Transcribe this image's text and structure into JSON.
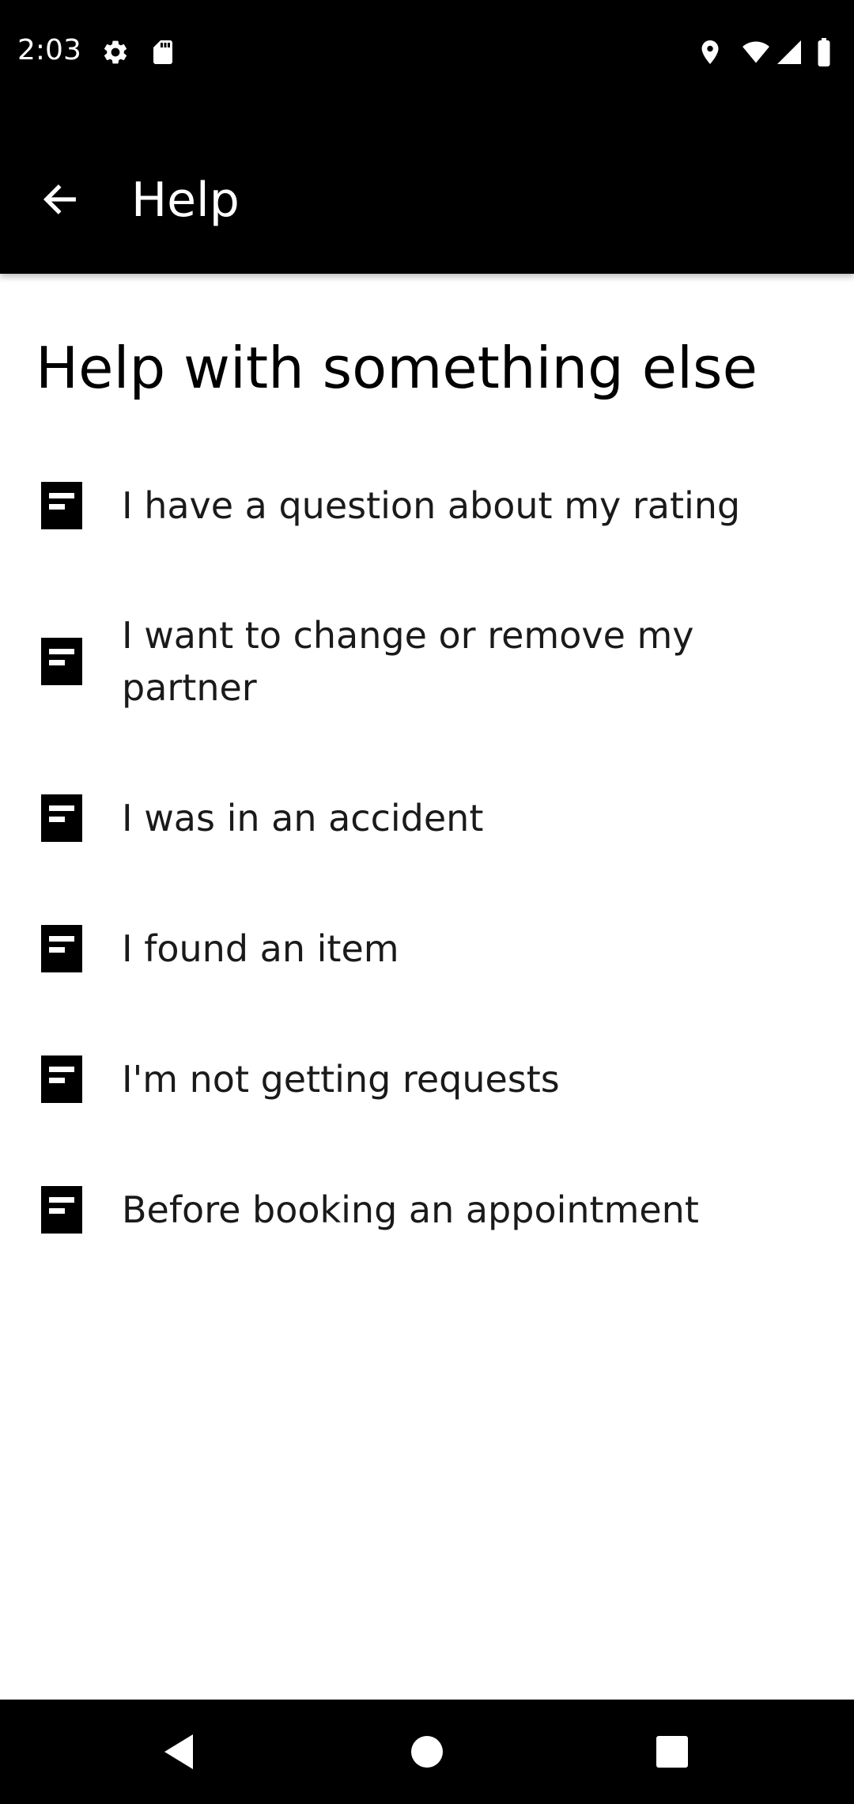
{
  "status_bar": {
    "time": "2:03",
    "icons_left": [
      "gear-icon",
      "sd-card-icon"
    ],
    "icons_right": [
      "location-icon",
      "wifi-icon",
      "signal-icon",
      "battery-icon"
    ]
  },
  "app_bar": {
    "title": "Help",
    "back_icon": "arrow-left-icon"
  },
  "section": {
    "title": "Help with something else"
  },
  "help_items": [
    {
      "label": "I have a question about my rating",
      "icon": "document-icon"
    },
    {
      "label": "I want to change or remove my partner",
      "icon": "document-icon"
    },
    {
      "label": "I was in an accident",
      "icon": "document-icon"
    },
    {
      "label": "I found an item",
      "icon": "document-icon"
    },
    {
      "label": "I'm not getting requests",
      "icon": "document-icon"
    },
    {
      "label": "Before booking an appointment",
      "icon": "document-icon"
    }
  ],
  "nav_bar": {
    "buttons": [
      "back-triangle-icon",
      "home-circle-icon",
      "recents-square-icon"
    ]
  },
  "colors": {
    "bar_background": "#000000",
    "page_background": "#ffffff",
    "text_primary": "#000000"
  }
}
